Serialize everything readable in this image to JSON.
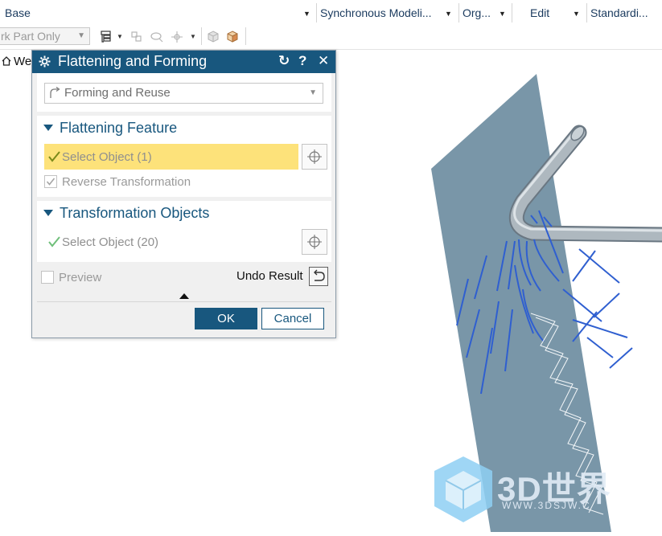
{
  "ribbon": {
    "items": [
      {
        "label": "Base"
      },
      {
        "label": "Synchronous Modeli..."
      },
      {
        "label": "Org..."
      },
      {
        "label": "Edit"
      },
      {
        "label": "Standardi..."
      }
    ]
  },
  "toolbar": {
    "filter_value": "rk Part Only"
  },
  "graphics_tab": {
    "label": "We"
  },
  "dialog": {
    "title": "Flattening and Forming",
    "type_value": "Forming and Reuse",
    "section_flatten": "Flattening Feature",
    "select_object_1": "Select Object (1)",
    "reverse_transformation": "Reverse Transformation",
    "section_transform": "Transformation Objects",
    "select_object_2": "Select Object (20)",
    "preview_label": "Preview",
    "undo_result_label": "Undo Result",
    "ok_label": "OK",
    "cancel_label": "Cancel"
  },
  "watermark": {
    "brand": "3D世界",
    "url": "WWW.3DSJW.C"
  },
  "colors": {
    "accent": "#18577e",
    "selection_highlight": "#fde27a",
    "sheet": "#7996a8",
    "curves": "#2f5fd0"
  }
}
